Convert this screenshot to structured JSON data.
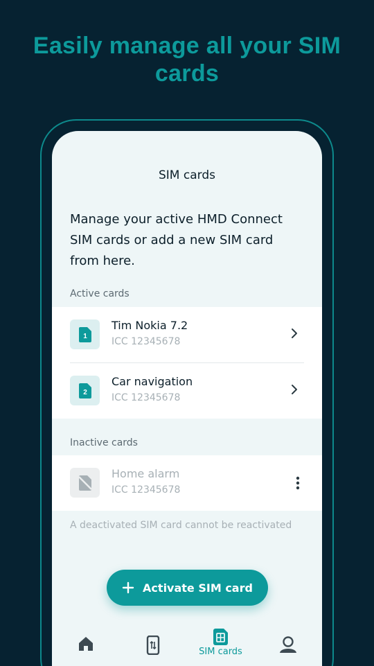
{
  "headline": "Easily manage all your SIM cards",
  "screen": {
    "title": "SIM cards",
    "intro": "Manage your active HMD Connect SIM cards or add a new SIM card from here.",
    "active_label": "Active cards",
    "inactive_label": "Inactive cards",
    "active_cards": [
      {
        "slot": "1",
        "name": "Tim Nokia 7.2",
        "icc": "ICC 12345678"
      },
      {
        "slot": "2",
        "name": "Car navigation",
        "icc": "ICC 12345678"
      }
    ],
    "inactive_cards": [
      {
        "name": "Home alarm",
        "icc": "ICC 12345678"
      }
    ],
    "footnote": "A deactivated SIM card cannot be reactivated",
    "activate_button": "Activate SIM card"
  },
  "nav": {
    "items": [
      {
        "icon": "home-icon",
        "label": ""
      },
      {
        "icon": "phone-transfer-icon",
        "label": ""
      },
      {
        "icon": "sim-card-icon",
        "label": "SIM cards"
      },
      {
        "icon": "profile-icon",
        "label": ""
      }
    ],
    "active_index": 2
  },
  "colors": {
    "background": "#062231",
    "accent": "#0d9a9b",
    "screen": "#eef6f7"
  }
}
